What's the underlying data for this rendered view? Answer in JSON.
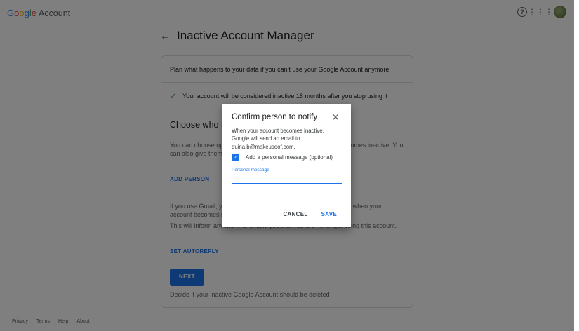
{
  "header": {
    "logo_google": "Google",
    "logo_account": "Account",
    "icons": [
      "help-icon",
      "apps-grid-icon",
      "avatar"
    ]
  },
  "title": "Inactive Account Manager",
  "card": {
    "intro": "Plan what happens to your data if you can't use your Google Account anymore",
    "inactive_notice": "Your account will be considered inactive 18 months after you stop using it",
    "choose_heading": "Choose who to notify & what to share",
    "choose_text": "You can choose up to 10 people to notify when your account becomes inactive. You can also give them access to some of your data.",
    "add_person": "ADD PERSON",
    "gmail_text": "If you use Gmail, you can also send an automatic reply to people when your account becomes inactive.",
    "inform_text": "This will inform anyone who emails you that you are no longer using this account.",
    "set_autoreply": "SET AUTOREPLY",
    "next": "NEXT",
    "delete_text": "Decide if your inactive Google Account should be deleted"
  },
  "footer": [
    "Privacy",
    "Terms",
    "Help",
    "About"
  ],
  "dialog": {
    "title": "Confirm person to notify",
    "body": "When your account becomes inactive, Google will send an email to quina.b@makeuseof.com.",
    "checkbox_label": "Add a personal message (optional)",
    "checkbox_checked": true,
    "field_label": "Personal message",
    "field_value": "",
    "cancel": "CANCEL",
    "save": "SAVE"
  }
}
